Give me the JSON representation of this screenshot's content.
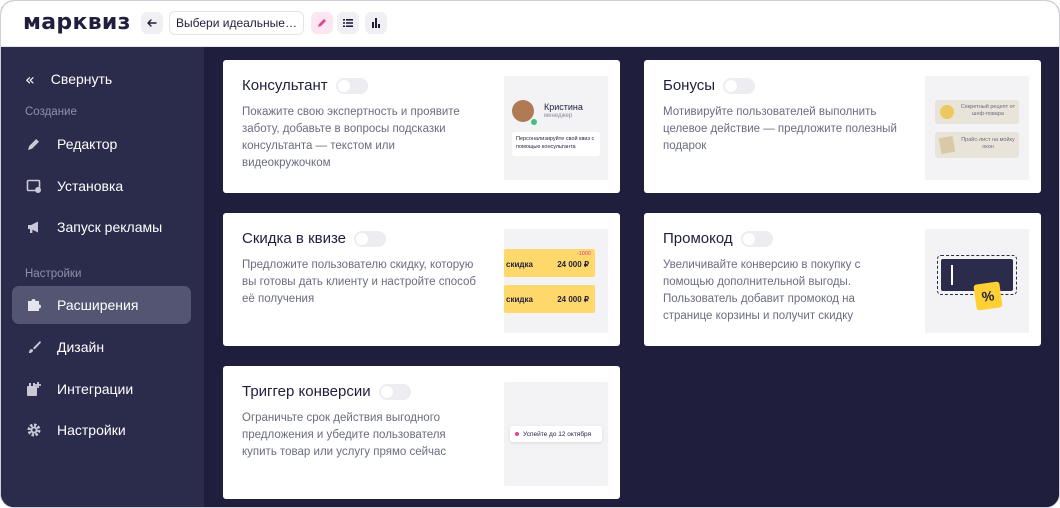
{
  "app": {
    "logo": "марквиз",
    "quiz_title": "Выбери идеальные к...",
    "icons": {
      "back": "arrow-left-icon",
      "edit": "pencil-icon",
      "list": "list-icon",
      "stats": "bar-chart-icon"
    },
    "accent": "#e0458f"
  },
  "sidebar": {
    "collapse_label": "Свернуть",
    "sections": [
      {
        "title": "Создание",
        "items": [
          {
            "label": "Редактор",
            "icon": "pencil-icon"
          },
          {
            "label": "Установка",
            "icon": "install-window-icon"
          },
          {
            "label": "Запуск рекламы",
            "icon": "megaphone-icon"
          }
        ]
      },
      {
        "title": "Настройки",
        "items": [
          {
            "label": "Расширения",
            "icon": "puzzle-icon",
            "active": true
          },
          {
            "label": "Дизайн",
            "icon": "brush-icon"
          },
          {
            "label": "Интеграции",
            "icon": "integrations-icon"
          },
          {
            "label": "Настройки",
            "icon": "gear-icon"
          }
        ]
      }
    ]
  },
  "cards": [
    {
      "title": "Консультант",
      "enabled": false,
      "description": "Покажите свою экспертность и проявите заботу, добавьте в вопросы подсказки консультанта — текстом или видеокружочком",
      "preview": {
        "name": "Кристина",
        "role": "менеджер",
        "note": "Персонализируйте свой квиз с помощью консультанта"
      }
    },
    {
      "title": "Бонусы",
      "enabled": false,
      "description": "Мотивируйте пользователей выполнить целевое действие — предложите полезный подарок",
      "preview": {
        "bonus1": "Секретный рецепт от шеф-повара",
        "bonus2": "Прайс-лист на мойку окон"
      }
    },
    {
      "title": "Скидка в квизе",
      "enabled": false,
      "description": "Предложите пользователю скидку, которую вы готовы дать клиенту и настройте способ её получения",
      "preview": {
        "badge": "-1000",
        "row_label": "скидка",
        "price": "24 000 ₽"
      }
    },
    {
      "title": "Промокод",
      "enabled": false,
      "description": "Увеличивайте конверсию в покупку с помощью дополнительной выгоды. Пользователь добавит промокод на странице корзины и получит скидку",
      "preview": {
        "symbol": "%"
      }
    },
    {
      "title": "Триггер конверсии",
      "enabled": false,
      "description": "Ограничьте срок действия выгодного предложения и убедите пользователя купить товар или услугу прямо сейчас",
      "preview": {
        "timer_text": "Успейте до 12 октября"
      }
    }
  ]
}
